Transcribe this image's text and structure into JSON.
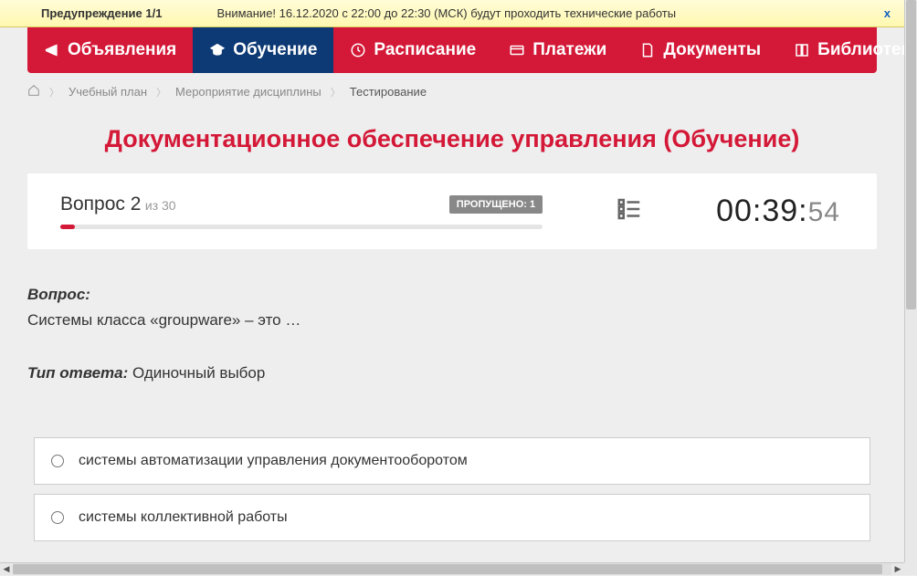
{
  "warning": {
    "label": "Предупреждение 1/1",
    "text": "Внимание! 16.12.2020 с 22:00 до 22:30 (МСК) будут проходить технические работы",
    "close": "x"
  },
  "nav": {
    "items": [
      {
        "label": "Объявления",
        "active": false
      },
      {
        "label": "Обучение",
        "active": true
      },
      {
        "label": "Расписание",
        "active": false
      },
      {
        "label": "Платежи",
        "active": false
      },
      {
        "label": "Документы",
        "active": false
      },
      {
        "label": "Библиотека",
        "active": false,
        "chevron": true
      }
    ]
  },
  "breadcrumb": {
    "items": [
      "Учебный план",
      "Мероприятие дисциплины",
      "Тестирование"
    ]
  },
  "page_title": "Документационное обеспечение управления (Обучение)",
  "status": {
    "question_label": "Вопрос 2",
    "of_total": "из 30",
    "skipped_badge": "ПРОПУЩЕНО: 1",
    "timer_main": "00:39:",
    "timer_sec": "54",
    "progress_percent": 3
  },
  "question": {
    "label": "Вопрос:",
    "text": "Системы класса «groupware» – это …",
    "answer_type_label": "Тип ответа:",
    "answer_type_value": "Одиночный выбор"
  },
  "answers": [
    "системы автоматизации управления документооборотом",
    "системы коллективной работы"
  ]
}
